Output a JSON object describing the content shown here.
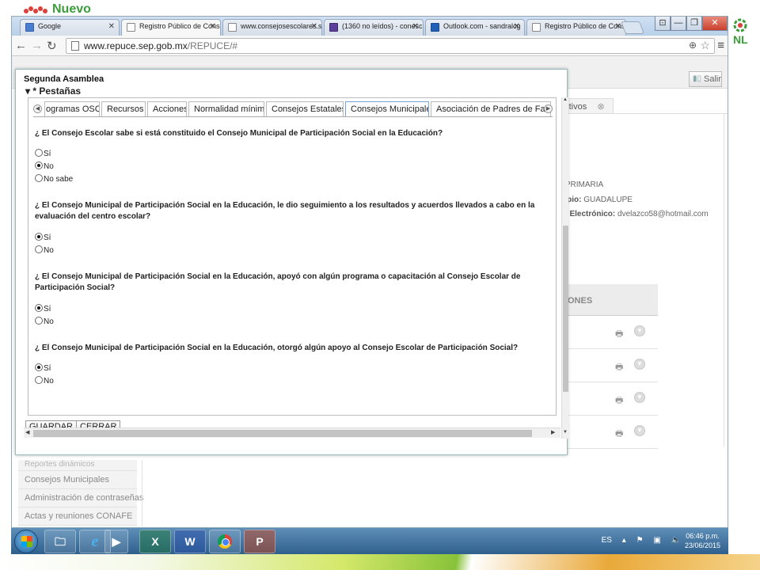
{
  "slide": {
    "logo_text": "Nuevo",
    "logo_right_text": "NL"
  },
  "browser": {
    "tabs": [
      {
        "label": "Google",
        "icon": "google-favicon"
      },
      {
        "label": "Registro Público de Conse",
        "icon": "page-icon",
        "active": true
      },
      {
        "label": "www.consejosescolares.se",
        "icon": "page-icon"
      },
      {
        "label": "(1360 no leídos) - conesc",
        "icon": "mail-icon"
      },
      {
        "label": "Outlook.com - sandralcg",
        "icon": "outlook-icon"
      },
      {
        "label": "Registro Público de Conse",
        "icon": "page-icon"
      }
    ],
    "url_host": "www.repuce.sep.gob.mx",
    "url_path": "/REPUCE/#",
    "window_controls": [
      "⊡",
      "—",
      "❐",
      "✕"
    ]
  },
  "background": {
    "salir_label": "Salir",
    "tab_label": "activos",
    "info": {
      "nivel_label": "l:",
      "nivel_value": "PRIMARIA",
      "municipio_label": "icipio:",
      "municipio_value": "GUADALUPE",
      "correo_label": "eo Electrónico:",
      "correo_value": "dvelazco58@hotmail.com"
    },
    "ops_header": "ONES",
    "left_nav": [
      "Reportes dinámicos",
      "Consejos Municipales",
      "Administración de contraseñas",
      "Actas y reuniones CONAFE"
    ]
  },
  "modal": {
    "title": "Segunda Asamblea",
    "section": "* Pestañas",
    "tabs": [
      "ogramas OSC",
      "Recursos",
      "Acciones",
      "Normalidad mínima",
      "Consejos Estatales",
      "Consejos Municipales",
      "Asociación de Padres de Familia"
    ],
    "active_tab": "Consejos Municipales",
    "questions": [
      {
        "text": "¿ El Consejo Escolar sabe si está constituido el Consejo Municipal de Participación Social en la Educación?",
        "options": [
          "Sí",
          "No",
          "No sabe"
        ],
        "selected": "No"
      },
      {
        "text": "¿ El Consejo Municipal de Participación Social en la Educación, le dio seguimiento a los resultados y acuerdos llevados a cabo en la evaluación del centro escolar?",
        "options": [
          "Sí",
          "No"
        ],
        "selected": "Sí"
      },
      {
        "text": "¿ El Consejo Municipal de Participación Social en la Educación, apoyó con algún programa o capacitación al Consejo Escolar de Participación Social?",
        "options": [
          "Sí",
          "No"
        ],
        "selected": "Sí"
      },
      {
        "text": "¿ El Consejo Municipal de Participación Social en la Educación, otorgó algún apoyo al Consejo Escolar de Participación Social?",
        "options": [
          "Sí",
          "No"
        ],
        "selected": "Sí"
      }
    ],
    "buttons": {
      "save": "GUARDAR",
      "close": "CERRAR"
    }
  },
  "taskbar": {
    "language": "ES",
    "time": "06:46 p.m.",
    "date": "23/06/2015"
  },
  "colors": {
    "accent_green": "#3a9c3a",
    "taskbar": "#2f5f8c",
    "active_tab_border": "#7aa3d6"
  }
}
